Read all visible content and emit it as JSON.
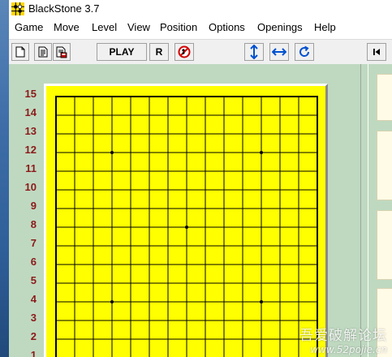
{
  "window": {
    "title": "BlackStone 3.7"
  },
  "menu": [
    {
      "label": "Game"
    },
    {
      "label": "Move"
    },
    {
      "label": "Level"
    },
    {
      "label": "View"
    },
    {
      "label": "Position"
    },
    {
      "label": "Options"
    },
    {
      "label": "Openings"
    },
    {
      "label": "Help"
    }
  ],
  "toolbar": {
    "buttons": [
      {
        "name": "new-game-button",
        "icon": "new-document-icon"
      },
      {
        "name": "open-game-button",
        "icon": "open-document-icon"
      },
      {
        "name": "save-game-button",
        "icon": "save-document-icon"
      },
      {
        "name": "play-button",
        "label": "PLAY"
      },
      {
        "name": "r-button",
        "label": "R"
      },
      {
        "name": "stop-button",
        "icon": "no-entry-icon"
      },
      {
        "name": "flip-vertical-button",
        "icon": "vertical-arrows-icon"
      },
      {
        "name": "flip-horizontal-button",
        "icon": "horizontal-arrows-icon"
      },
      {
        "name": "rotate-button",
        "icon": "rotate-icon"
      },
      {
        "name": "first-move-button",
        "icon": "skip-to-start-icon"
      }
    ]
  },
  "board": {
    "size": 15,
    "row_labels": [
      "15",
      "14",
      "13",
      "12",
      "11",
      "10",
      "9",
      "8",
      "7",
      "6",
      "5",
      "4",
      "3",
      "2",
      "1"
    ],
    "star_points": [
      [
        4,
        12
      ],
      [
        12,
        12
      ],
      [
        8,
        8
      ],
      [
        4,
        4
      ],
      [
        12,
        4
      ]
    ],
    "board_color": "#ffff00",
    "line_color": "#000000",
    "label_color": "#8b1a1a"
  },
  "background_color": "#bfd9c0",
  "watermark": {
    "line1": "吾爱破解论坛",
    "line2": "www.52pojie.cn"
  }
}
